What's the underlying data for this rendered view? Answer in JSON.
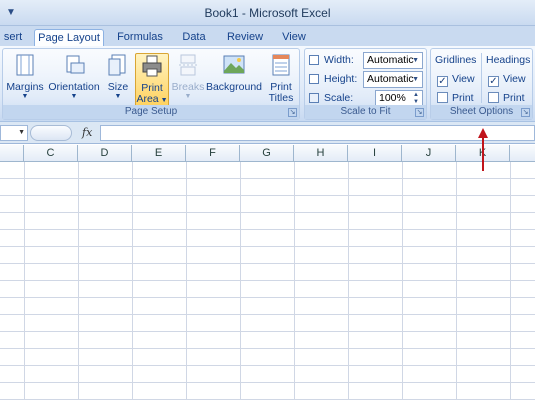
{
  "window": {
    "title": "Book1 - Microsoft Excel",
    "qat_icon": "dropdown-caret-icon"
  },
  "tabs": [
    {
      "label": "sert",
      "active": false
    },
    {
      "label": "Page Layout",
      "active": true
    },
    {
      "label": "Formulas",
      "active": false
    },
    {
      "label": "Data",
      "active": false
    },
    {
      "label": "Review",
      "active": false
    },
    {
      "label": "View",
      "active": false
    }
  ],
  "page_setup": {
    "label": "Page Setup",
    "margins": "Margins",
    "orientation": "Orientation",
    "size": "Size",
    "print_area_line1": "Print",
    "print_area_line2": "Area",
    "breaks": "Breaks",
    "background": "Background",
    "print_titles_line1": "Print",
    "print_titles_line2": "Titles"
  },
  "scale_to_fit": {
    "label": "Scale to Fit",
    "width_label": "Width:",
    "width_value": "Automatic",
    "height_label": "Height:",
    "height_value": "Automatic",
    "scale_label": "Scale:",
    "scale_value": "100%"
  },
  "sheet_options": {
    "label": "Sheet Options",
    "gridlines": "Gridlines",
    "headings": "Headings",
    "gridlines_view": {
      "label": "View",
      "checked": true
    },
    "gridlines_print": {
      "label": "Print",
      "checked": false
    },
    "headings_view": {
      "label": "View",
      "checked": true
    },
    "headings_print": {
      "label": "Print",
      "checked": false
    }
  },
  "formula_bar": {
    "fx": "fx",
    "value": ""
  },
  "columns": [
    "C",
    "D",
    "E",
    "F",
    "G",
    "H",
    "I",
    "J",
    "K"
  ],
  "colors": {
    "accent_arrow": "#c0141b",
    "ribbon_text": "#15428b",
    "highlight": "#ffd25f"
  }
}
